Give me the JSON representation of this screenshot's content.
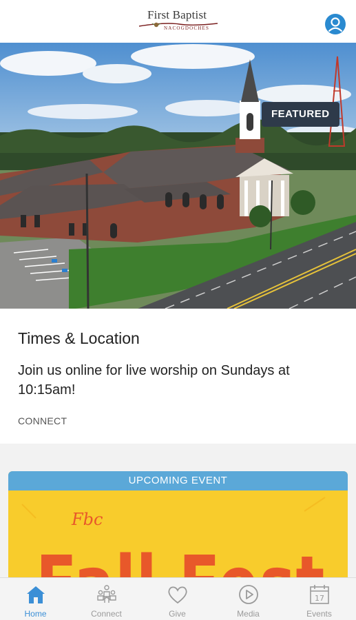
{
  "header": {
    "logo": {
      "line1": "First Baptist",
      "line2": "NACOGDOCHES"
    },
    "profile_icon": "user-circle-icon"
  },
  "featured": {
    "badge": "FEATURED",
    "title": "Times & Location",
    "description": "Join us online for live worship on Sundays at 10:15am!",
    "cta": "CONNECT"
  },
  "event": {
    "header": "UPCOMING EVENT",
    "art_line1": "Fbc",
    "art_line2": "Fall Fest",
    "colors": {
      "background": "#f8cc2c",
      "lettering": "#e8582a",
      "header": "#5ba8d8"
    }
  },
  "tabbar": {
    "active": "Home",
    "tabs": [
      {
        "label": "Home",
        "icon": "home-icon"
      },
      {
        "label": "Connect",
        "icon": "people-icon"
      },
      {
        "label": "Give",
        "icon": "heart-icon"
      },
      {
        "label": "Media",
        "icon": "play-circle-icon"
      },
      {
        "label": "Events",
        "icon": "calendar-icon"
      }
    ]
  },
  "colors": {
    "accent": "#3b8fd6",
    "badge": "#2e3a4a"
  }
}
